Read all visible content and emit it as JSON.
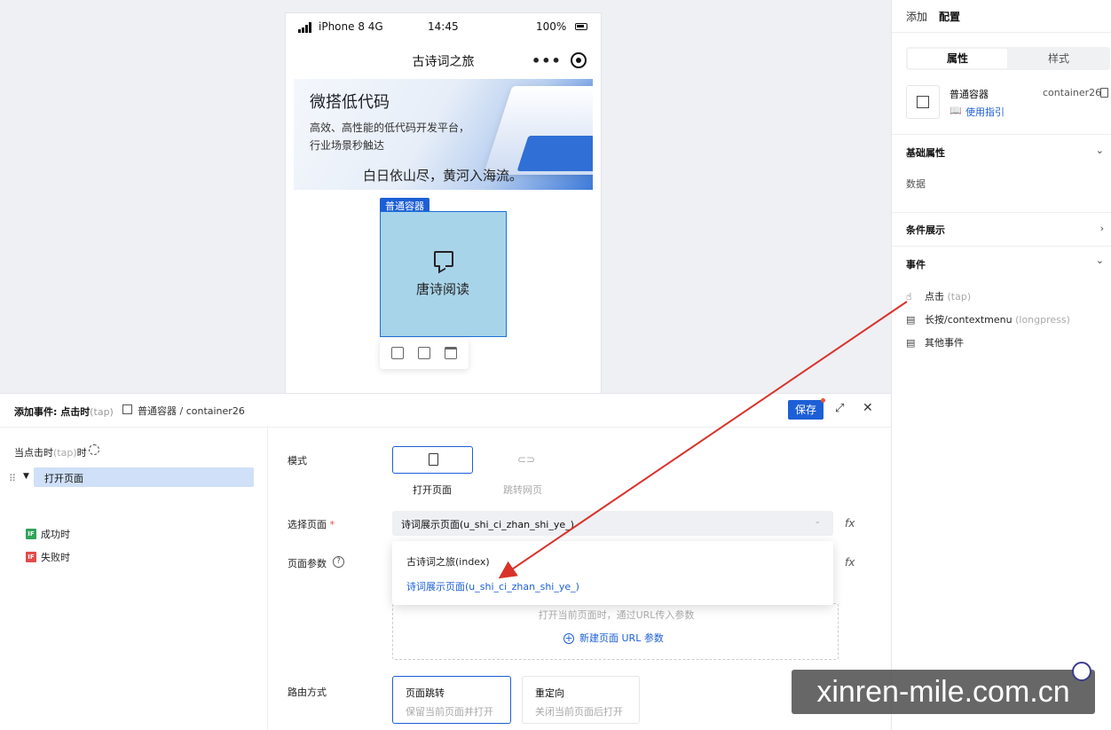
{
  "phone": {
    "carrier": "iPhone 8  4G",
    "time": "14:45",
    "battery": "100%",
    "nav_title": "古诗词之旅",
    "more_icon": "•••",
    "banner": {
      "title": "微搭低代码",
      "subtitle1": "高效、高性能的低代码开发平台，",
      "subtitle2": "行业场景秒触达",
      "poem": "白日依山尽，黄河入海流。"
    },
    "container_tag": "普通容器",
    "container_label": "唐诗阅读"
  },
  "right_panel": {
    "tabs": [
      "添加",
      "配置"
    ],
    "segments": [
      "属性",
      "样式"
    ],
    "component_name": "普通容器",
    "component_id": "container26",
    "guide_link": "使用指引",
    "sections": {
      "basic": "基础属性",
      "data": "数据",
      "conditional": "条件展示",
      "events": "事件"
    },
    "events": [
      {
        "label": "点击",
        "hint": "(tap)"
      },
      {
        "label": "长按/contextmenu",
        "hint": "(longpress)"
      },
      {
        "label": "其他事件",
        "hint": ""
      }
    ]
  },
  "bottom_panel": {
    "title": "添加事件: 点击时",
    "title_hint": "(tap)",
    "breadcrumb": "普通容器 / container26",
    "save_label": "保存",
    "trigger_prefix": "当点击时",
    "trigger_hint": "(tap)",
    "trigger_suffix": "时",
    "action_label": "打开页面",
    "success_badge": "IF",
    "success_label": "成功时",
    "fail_badge": "IF",
    "fail_label": "失败时",
    "form": {
      "mode_label": "模式",
      "mode_open": "打开页面",
      "mode_link": "跳转网页",
      "select_page_label": "选择页面",
      "select_page_required": "*",
      "select_page_value": "诗词展示页面(u_shi_ci_zhan_shi_ye_)",
      "page_params_label": "页面参数",
      "fx": "fx",
      "dropdown_options": [
        "古诗词之旅(index)",
        "诗词展示页面(u_shi_ci_zhan_shi_ye_)"
      ],
      "params_hint": "打开当前页面时，通过URL传入参数",
      "add_param": "新建页面 URL 参数",
      "route_label": "路由方式",
      "route_push_title": "页面跳转",
      "route_push_desc": "保留当前页面并打开",
      "route_redirect_title": "重定向",
      "route_redirect_desc": "关闭当前页面后打开"
    }
  },
  "watermark": "xinren-mile.com.cn",
  "colors": {
    "accent": "#1c5fd6",
    "arrow": "#d9322a",
    "container_fill": "#a8d4ea"
  }
}
